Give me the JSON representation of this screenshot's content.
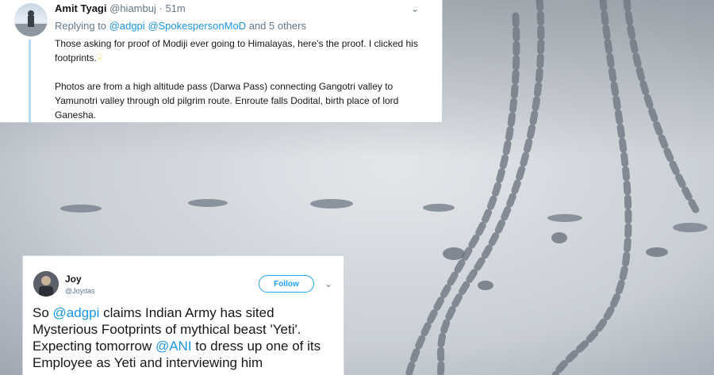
{
  "tweet1": {
    "name": "Amit Tyagi",
    "handle": "@hiambuj",
    "separator": "·",
    "time": "51m",
    "replying_prefix": "Replying to",
    "reply_mentions": [
      "@adgpi",
      "@SpokespersonMoD"
    ],
    "reply_suffix": "and 5 others",
    "text_line1": "Those asking for proof of Modiji ever going to Himalayas, here's the proof. I clicked his footprints.",
    "text_line2": "Photos are from a high altitude pass (Darwa Pass) connecting Gangotri valley to Yamunotri valley through old pilgrim route. Enroute falls Dodital, birth place of lord Ganesha.",
    "emoji_icon": "pointing-down-hand-icon"
  },
  "tweet2": {
    "name": "Joy",
    "handle": "@Joydas",
    "follow_label": "Follow",
    "text_before": "So ",
    "mention1": "@adgpi",
    "text_middle": " claims Indian Army has sited Mysterious Footprints of mythical beast 'Yeti'. Expecting tomorrow ",
    "mention2": "@ANI",
    "text_after": " to dress up one of its Employee as Yeti and interviewing him"
  },
  "colors": {
    "link": "#1b95e0",
    "follow": "#1da1f2",
    "muted": "#657786",
    "text": "#14171a",
    "thread": "#b8dcf4"
  },
  "background": {
    "description_icon": "snow-footprints-photo"
  }
}
